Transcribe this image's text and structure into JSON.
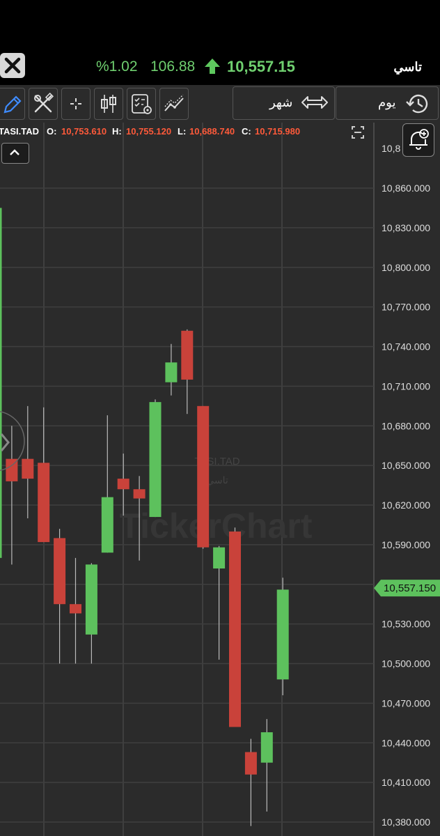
{
  "header": {
    "symbol_title": "تاسي",
    "price": "10,557.15",
    "change": "106.88",
    "change_pct": "%1.02",
    "up_color": "#6fcf6f"
  },
  "toolbar": {
    "period_day_label": "يوم",
    "period_month_label": "شهر",
    "icons": [
      "close-icon",
      "pencil-icon",
      "tools-icon",
      "crosshair-icon",
      "candlestick-icon",
      "indicators-settings-icon",
      "trend-chart-icon",
      "swap-icon",
      "history-icon"
    ]
  },
  "ohlc": {
    "symbol": "TASI.TAD",
    "open_label": "O:",
    "open": "10,753.610",
    "high_label": "H:",
    "high": "10,755.120",
    "low_label": "L:",
    "low": "10,688.740",
    "close_label": "C:",
    "close": "10,715.980"
  },
  "watermark": {
    "symbol": "TASI.TAD",
    "symbol_ar": "تاسي",
    "brand": "TickerChart"
  },
  "chart_data": {
    "type": "candlestick",
    "up_color": "#5dc15d",
    "down_color": "#c9423a",
    "y_ticks": [
      "10,860.000",
      "10,830.000",
      "10,800.000",
      "10,770.000",
      "10,740.000",
      "10,710.000",
      "10,680.000",
      "10,650.000",
      "10,620.000",
      "10,590.000",
      "10,530.000",
      "10,500.000",
      "10,470.000",
      "10,440.000",
      "10,410.000",
      "10,380.000"
    ],
    "y_tick_values": [
      10860,
      10830,
      10800,
      10770,
      10740,
      10710,
      10680,
      10650,
      10620,
      10590,
      10530,
      10500,
      10470,
      10440,
      10410,
      10380
    ],
    "y_top_partial_label": "10,8",
    "last_price_label": "10,557.150",
    "last_price": 10557.15,
    "candles": [
      {
        "o": 10580,
        "h": 10855,
        "l": 10555,
        "c": 10845
      },
      {
        "o": 10655,
        "h": 10680,
        "l": 10575,
        "c": 10638
      },
      {
        "o": 10655,
        "h": 10695,
        "l": 10610,
        "c": 10640
      },
      {
        "o": 10652,
        "h": 10694,
        "l": 10592,
        "c": 10592
      },
      {
        "o": 10595,
        "h": 10602,
        "l": 10500,
        "c": 10545
      },
      {
        "o": 10545,
        "h": 10580,
        "l": 10500,
        "c": 10538
      },
      {
        "o": 10522,
        "h": 10576,
        "l": 10500,
        "c": 10575
      },
      {
        "o": 10584,
        "h": 10688,
        "l": 10584,
        "c": 10626
      },
      {
        "o": 10640,
        "h": 10659,
        "l": 10612,
        "c": 10632
      },
      {
        "o": 10632,
        "h": 10642,
        "l": 10578,
        "c": 10625
      },
      {
        "o": 10611,
        "h": 10700,
        "l": 10611,
        "c": 10698
      },
      {
        "o": 10713,
        "h": 10742,
        "l": 10703,
        "c": 10728
      },
      {
        "o": 10752,
        "h": 10753,
        "l": 10689,
        "c": 10715
      },
      {
        "o": 10695,
        "h": 10695,
        "l": 10587,
        "c": 10588
      },
      {
        "o": 10572,
        "h": 10589,
        "l": 10503,
        "c": 10588
      },
      {
        "o": 10600,
        "h": 10603,
        "l": 10452,
        "c": 10452
      },
      {
        "o": 10433,
        "h": 10443,
        "l": 10377,
        "c": 10416
      },
      {
        "o": 10425,
        "h": 10458,
        "l": 10388,
        "c": 10448
      },
      {
        "o": 10488,
        "h": 10565,
        "l": 10476,
        "c": 10556
      }
    ]
  }
}
